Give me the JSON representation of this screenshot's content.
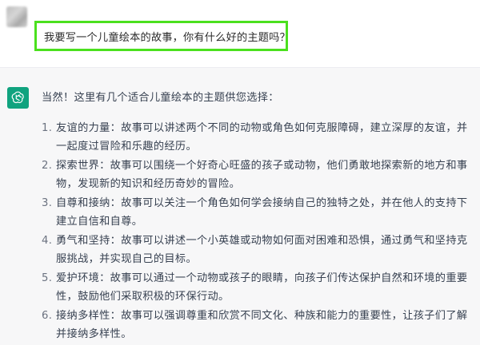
{
  "user": {
    "message": "我要写一个儿童绘本的故事，你有什么好的主题吗？"
  },
  "assistant": {
    "intro": "当然！这里有几个适合儿童绘本的主题供您选择：",
    "items": [
      {
        "num": "1.",
        "text": "友谊的力量：故事可以讲述两个不同的动物或角色如何克服障碍，建立深厚的友谊，并一起度过冒险和乐趣的经历。"
      },
      {
        "num": "2.",
        "text": "探索世界：故事可以围绕一个好奇心旺盛的孩子或动物，他们勇敢地探索新的地方和事物，发现新的知识和经历奇妙的冒险。"
      },
      {
        "num": "3.",
        "text": "自尊和接纳：故事可以关注一个角色如何学会接纳自己的独特之处，并在他人的支持下建立自信和自尊。"
      },
      {
        "num": "4.",
        "text": "勇气和坚持：故事可以讲述一个小英雄或动物如何面对困难和恐惧，通过勇气和坚持克服挑战，并实现自己的目标。"
      },
      {
        "num": "5.",
        "text": "爱护环境：故事可以通过一个动物或孩子的眼睛，向孩子们传达保护自然和环境的重要性，鼓励他们采取积极的环保行动。"
      },
      {
        "num": "6.",
        "text": "接纳多样性：故事可以强调尊重和欣赏不同文化、种族和能力的重要性，让孩子们了解并接纳多样性。"
      }
    ]
  },
  "icons": {
    "user_avatar": "user-avatar-icon",
    "assistant_avatar": "chatgpt-logo-icon"
  },
  "colors": {
    "highlight_border": "#4be01e",
    "assistant_bg": "#f7f7f8",
    "avatar_green": "#10a37f"
  }
}
